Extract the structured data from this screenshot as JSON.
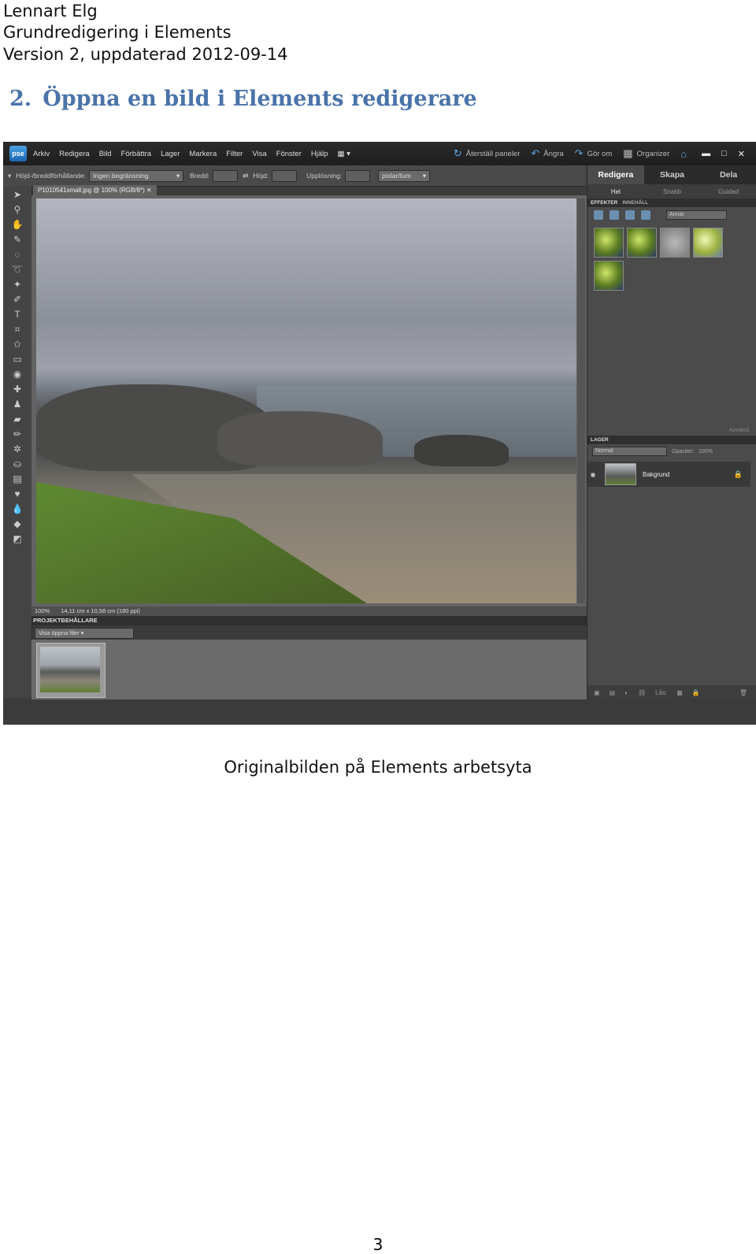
{
  "header": {
    "author": "Lennart Elg",
    "doc_title": "Grundredigering  i Elements",
    "version": "Version 2, uppdaterad 2012-09-14"
  },
  "section": {
    "number": "2.",
    "title": "Öppna en bild i Elements redigerare"
  },
  "screenshot": {
    "app_logo": "pse",
    "menu": [
      "Arkiv",
      "Redigera",
      "Bild",
      "Förbättra",
      "Lager",
      "Markera",
      "Filter",
      "Visa",
      "Fönster",
      "Hjälp"
    ],
    "reset_panels": "Återställ paneler",
    "undo": "Ångra",
    "redo": "Gör om",
    "organizer": "Organizer",
    "options": {
      "ratio_label": "Höjd-/breddförhållande:",
      "ratio_value": "Ingen begränsning",
      "width_label": "Bredd:",
      "height_label": "Höjd:",
      "resolution_label": "Upplösning:",
      "unit_value": "pixlar/tum"
    },
    "doc_tab": "P1010541small.jpg @ 100% (RGB/8*)",
    "status": {
      "zoom": "100%",
      "size": "14,11 cm x 10,58 cm (180 ppi)"
    },
    "project_bin": {
      "title": "PROJEKTBEHÅLLARE",
      "select": "Visa öppna filer"
    },
    "right_panel": {
      "tabs": [
        "Redigera",
        "Skapa",
        "Dela"
      ],
      "subtabs": [
        "Hel",
        "Snabb",
        "Guidad"
      ],
      "effects_tabs": [
        "EFFEKTER",
        "INNEHÅLL"
      ],
      "effects_select": "Annat",
      "apply": "Använd",
      "layers_title": "LAGER",
      "blend_mode": "Normal",
      "opacity_label": "Opacitet:",
      "opacity_value": "100%",
      "layer_name": "Bakgrund",
      "lock_label": "Lås:"
    }
  },
  "caption": "Originalbilden på Elements arbetsyta",
  "page_number": "3"
}
